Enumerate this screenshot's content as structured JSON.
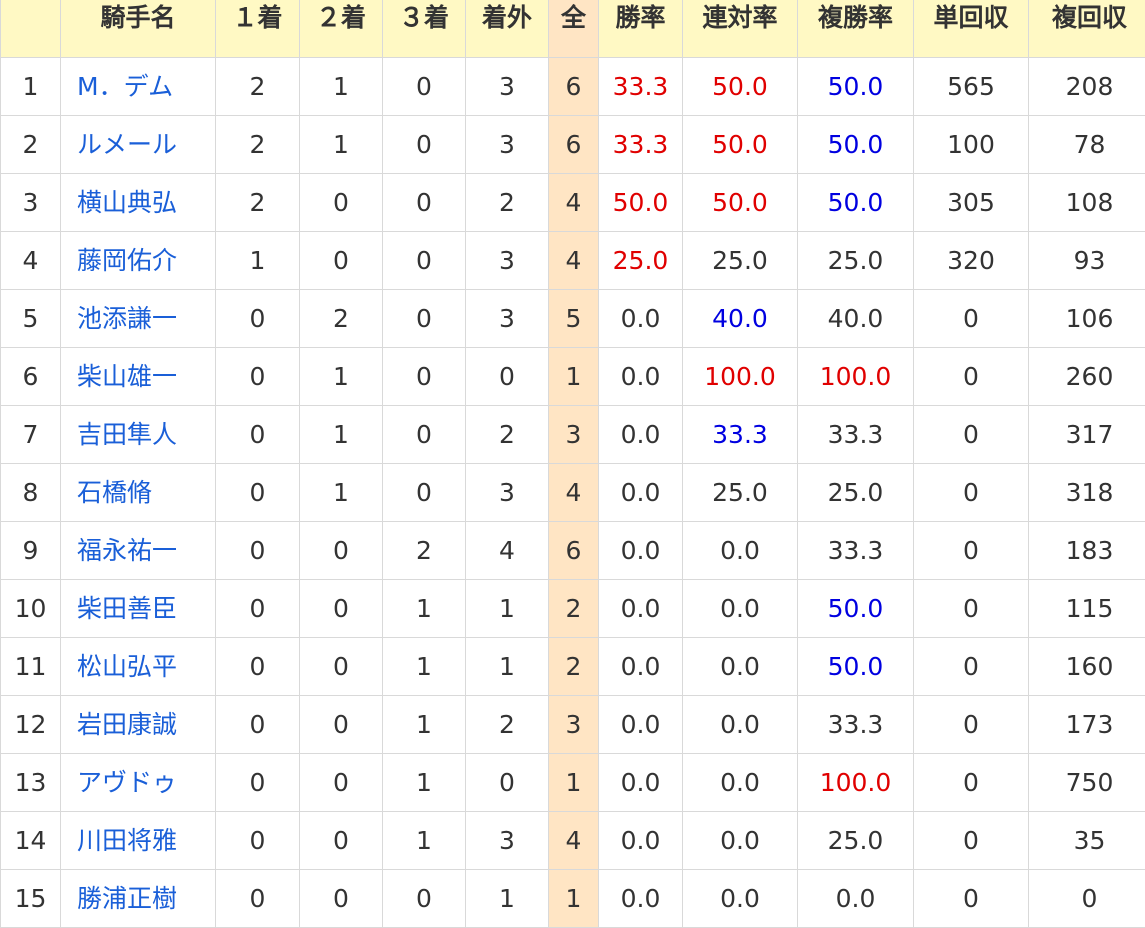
{
  "headers": [
    "",
    "騎手名",
    "１着",
    "２着",
    "３着",
    "着外",
    "全",
    "勝率",
    "連対率",
    "複勝率",
    "単回収",
    "複回収"
  ],
  "colors": {
    "header_bg": "#fff9c4",
    "total_bg": "#ffe5c4",
    "link": "#1a5fd8",
    "highlight_red": "#e00000",
    "highlight_blue": "#0000e0"
  },
  "rows": [
    {
      "rank": "1",
      "name": "M．デム",
      "first": "2",
      "second": "1",
      "third": "0",
      "other": "3",
      "total": "6",
      "win_rate": "33.3",
      "win_rate_color": "red",
      "quinella_rate": "50.0",
      "quinella_rate_color": "red",
      "place_rate": "50.0",
      "place_rate_color": "blue",
      "win_return": "565",
      "place_return": "208"
    },
    {
      "rank": "2",
      "name": "ルメール",
      "first": "2",
      "second": "1",
      "third": "0",
      "other": "3",
      "total": "6",
      "win_rate": "33.3",
      "win_rate_color": "red",
      "quinella_rate": "50.0",
      "quinella_rate_color": "red",
      "place_rate": "50.0",
      "place_rate_color": "blue",
      "win_return": "100",
      "place_return": "78"
    },
    {
      "rank": "3",
      "name": "横山典弘",
      "first": "2",
      "second": "0",
      "third": "0",
      "other": "2",
      "total": "4",
      "win_rate": "50.0",
      "win_rate_color": "red",
      "quinella_rate": "50.0",
      "quinella_rate_color": "red",
      "place_rate": "50.0",
      "place_rate_color": "blue",
      "win_return": "305",
      "place_return": "108"
    },
    {
      "rank": "4",
      "name": "藤岡佑介",
      "first": "1",
      "second": "0",
      "third": "0",
      "other": "3",
      "total": "4",
      "win_rate": "25.0",
      "win_rate_color": "red",
      "quinella_rate": "25.0",
      "quinella_rate_color": "def",
      "place_rate": "25.0",
      "place_rate_color": "def",
      "win_return": "320",
      "place_return": "93"
    },
    {
      "rank": "5",
      "name": "池添謙一",
      "first": "0",
      "second": "2",
      "third": "0",
      "other": "3",
      "total": "5",
      "win_rate": "0.0",
      "win_rate_color": "def",
      "quinella_rate": "40.0",
      "quinella_rate_color": "blue",
      "place_rate": "40.0",
      "place_rate_color": "def",
      "win_return": "0",
      "place_return": "106"
    },
    {
      "rank": "6",
      "name": "柴山雄一",
      "first": "0",
      "second": "1",
      "third": "0",
      "other": "0",
      "total": "1",
      "win_rate": "0.0",
      "win_rate_color": "def",
      "quinella_rate": "100.0",
      "quinella_rate_color": "red",
      "place_rate": "100.0",
      "place_rate_color": "red",
      "win_return": "0",
      "place_return": "260"
    },
    {
      "rank": "7",
      "name": "吉田隼人",
      "first": "0",
      "second": "1",
      "third": "0",
      "other": "2",
      "total": "3",
      "win_rate": "0.0",
      "win_rate_color": "def",
      "quinella_rate": "33.3",
      "quinella_rate_color": "blue",
      "place_rate": "33.3",
      "place_rate_color": "def",
      "win_return": "0",
      "place_return": "317"
    },
    {
      "rank": "8",
      "name": "石橋脩",
      "first": "0",
      "second": "1",
      "third": "0",
      "other": "3",
      "total": "4",
      "win_rate": "0.0",
      "win_rate_color": "def",
      "quinella_rate": "25.0",
      "quinella_rate_color": "def",
      "place_rate": "25.0",
      "place_rate_color": "def",
      "win_return": "0",
      "place_return": "318"
    },
    {
      "rank": "9",
      "name": "福永祐一",
      "first": "0",
      "second": "0",
      "third": "2",
      "other": "4",
      "total": "6",
      "win_rate": "0.0",
      "win_rate_color": "def",
      "quinella_rate": "0.0",
      "quinella_rate_color": "def",
      "place_rate": "33.3",
      "place_rate_color": "def",
      "win_return": "0",
      "place_return": "183"
    },
    {
      "rank": "10",
      "name": "柴田善臣",
      "first": "0",
      "second": "0",
      "third": "1",
      "other": "1",
      "total": "2",
      "win_rate": "0.0",
      "win_rate_color": "def",
      "quinella_rate": "0.0",
      "quinella_rate_color": "def",
      "place_rate": "50.0",
      "place_rate_color": "blue",
      "win_return": "0",
      "place_return": "115"
    },
    {
      "rank": "11",
      "name": "松山弘平",
      "first": "0",
      "second": "0",
      "third": "1",
      "other": "1",
      "total": "2",
      "win_rate": "0.0",
      "win_rate_color": "def",
      "quinella_rate": "0.0",
      "quinella_rate_color": "def",
      "place_rate": "50.0",
      "place_rate_color": "blue",
      "win_return": "0",
      "place_return": "160"
    },
    {
      "rank": "12",
      "name": "岩田康誠",
      "first": "0",
      "second": "0",
      "third": "1",
      "other": "2",
      "total": "3",
      "win_rate": "0.0",
      "win_rate_color": "def",
      "quinella_rate": "0.0",
      "quinella_rate_color": "def",
      "place_rate": "33.3",
      "place_rate_color": "def",
      "win_return": "0",
      "place_return": "173"
    },
    {
      "rank": "13",
      "name": "アヴドゥ",
      "first": "0",
      "second": "0",
      "third": "1",
      "other": "0",
      "total": "1",
      "win_rate": "0.0",
      "win_rate_color": "def",
      "quinella_rate": "0.0",
      "quinella_rate_color": "def",
      "place_rate": "100.0",
      "place_rate_color": "red",
      "win_return": "0",
      "place_return": "750"
    },
    {
      "rank": "14",
      "name": "川田将雅",
      "first": "0",
      "second": "0",
      "third": "1",
      "other": "3",
      "total": "4",
      "win_rate": "0.0",
      "win_rate_color": "def",
      "quinella_rate": "0.0",
      "quinella_rate_color": "def",
      "place_rate": "25.0",
      "place_rate_color": "def",
      "win_return": "0",
      "place_return": "35"
    },
    {
      "rank": "15",
      "name": "勝浦正樹",
      "first": "0",
      "second": "0",
      "third": "0",
      "other": "1",
      "total": "1",
      "win_rate": "0.0",
      "win_rate_color": "def",
      "quinella_rate": "0.0",
      "quinella_rate_color": "def",
      "place_rate": "0.0",
      "place_rate_color": "def",
      "win_return": "0",
      "place_return": "0"
    }
  ]
}
